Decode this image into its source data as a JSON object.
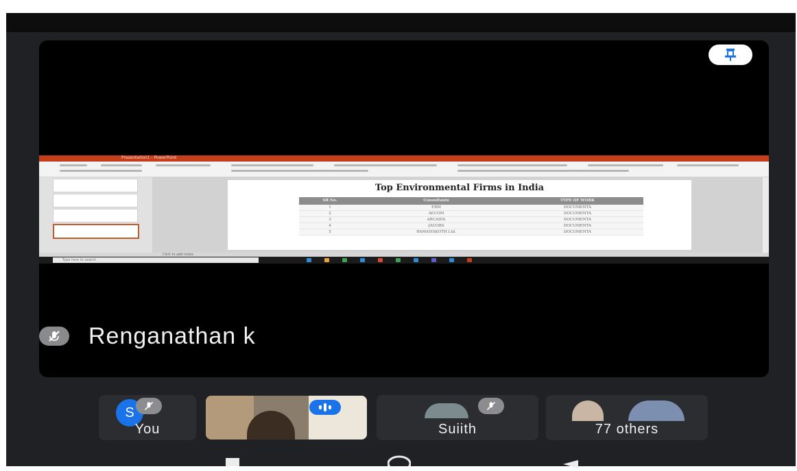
{
  "main_speaker": {
    "name": "Renganathan k"
  },
  "shared_slide": {
    "title": "Top Environmental Firms in India",
    "columns": [
      "SR No.",
      "Consultants",
      "TYPE OF WORK"
    ],
    "rows": [
      [
        "1",
        "ERM",
        "DOCUMENTA"
      ],
      [
        "2",
        "AECOM",
        "DOCUMENTA"
      ],
      [
        "3",
        "ARCADIS",
        "DOCUMENTA"
      ],
      [
        "4",
        "JACOBS",
        "DOCUMENTA"
      ],
      [
        "5",
        "RAMAIYAKOTH Ltd.",
        "DOCUMENTA"
      ]
    ],
    "window_title": "Presentation1 - PowerPoint",
    "notes_hint": "Click to add notes",
    "taskbar_search": "Type here to search"
  },
  "participants": [
    {
      "label": "You",
      "avatar_letter": "S",
      "muted": true
    },
    {
      "label": "",
      "speaking": true
    },
    {
      "label": "Suiith",
      "muted": true
    },
    {
      "label": "77 others"
    }
  ],
  "colors": {
    "accent_blue": "#1a73e8",
    "stage_bg": "#000000",
    "app_bg": "#202124",
    "ppt_orange": "#c43e1c"
  },
  "icons": [
    "pin-icon",
    "mic-off-icon",
    "speaking-indicator-icon",
    "nav-square-icon",
    "nav-home-icon",
    "nav-back-icon"
  ]
}
